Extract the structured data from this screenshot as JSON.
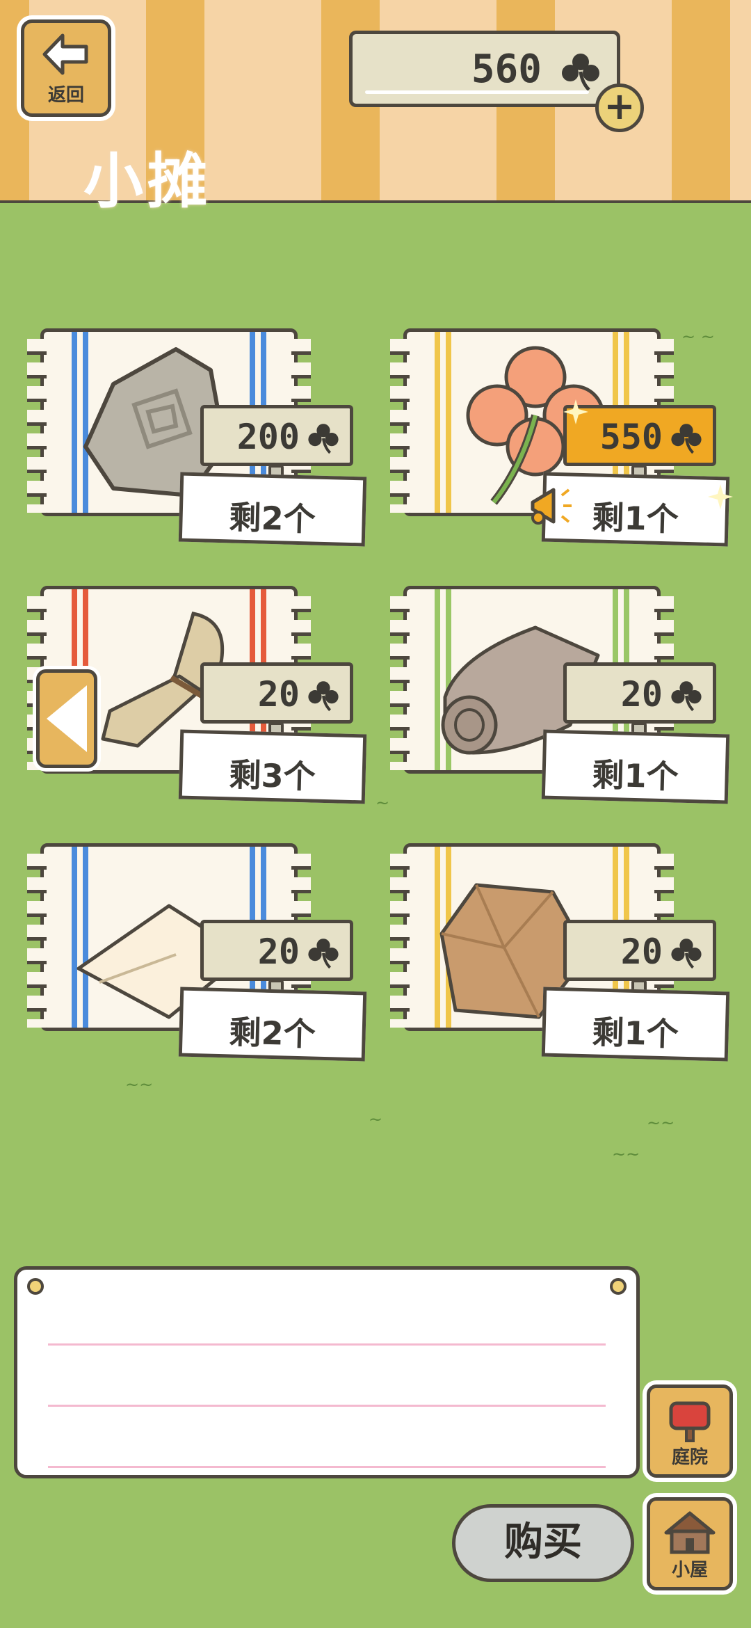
{
  "header": {
    "back_label": "返回",
    "title": "小摊",
    "currency_amount": "560",
    "currency_icon": "clover-icon",
    "add_label": "+"
  },
  "items": [
    {
      "name": "stone",
      "price": "200",
      "stock": "剩2个",
      "stripe_color": "#4a8bdc",
      "highlight": false
    },
    {
      "name": "four-leaf-clover",
      "price": "550",
      "stock": "剩1个",
      "stripe_color": "#f0c64a",
      "highlight": true
    },
    {
      "name": "broom",
      "price": "20",
      "stock": "剩3个",
      "stripe_color": "#e55b3c",
      "highlight": false
    },
    {
      "name": "cloth-roll",
      "price": "20",
      "stock": "剩1个",
      "stripe_color": "#9ac766",
      "highlight": false
    },
    {
      "name": "cloth",
      "price": "20",
      "stock": "剩2个",
      "stripe_color": "#4a8bdc",
      "highlight": false
    },
    {
      "name": "paper-bag",
      "price": "20",
      "stock": "剩1个",
      "stripe_color": "#f0c64a",
      "highlight": false
    }
  ],
  "bottom": {
    "yard_label": "庭院",
    "house_label": "小屋",
    "buy_label": "购买"
  },
  "colors": {
    "grass": "#9bc266",
    "wood": "#e7b65e",
    "outline": "#4d473e",
    "price_highlight": "#f0a823"
  }
}
